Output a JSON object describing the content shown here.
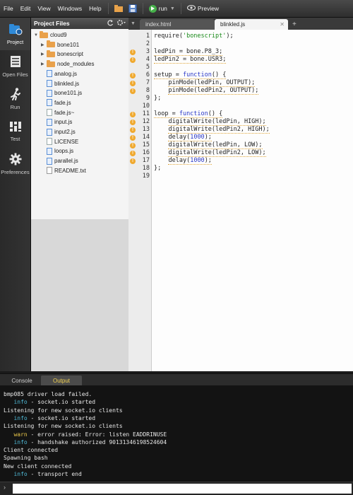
{
  "menubar": {
    "items": [
      "File",
      "Edit",
      "View",
      "Windows",
      "Help"
    ],
    "run_label": "run",
    "preview_label": "Preview"
  },
  "leftbar": {
    "items": [
      {
        "label": "Project",
        "icon": "project-icon",
        "active": true
      },
      {
        "label": "Open Files",
        "icon": "open-files-icon",
        "active": false
      },
      {
        "label": "Run",
        "icon": "run-icon",
        "active": false
      },
      {
        "label": "Test",
        "icon": "test-icon",
        "active": false
      },
      {
        "label": "Preferences",
        "icon": "preferences-icon",
        "active": false
      }
    ]
  },
  "tree": {
    "title": "Project Files",
    "items": [
      {
        "name": "cloud9",
        "type": "folder",
        "expanded": true,
        "depth": 0
      },
      {
        "name": "bone101",
        "type": "folder",
        "expanded": false,
        "depth": 1
      },
      {
        "name": "bonescript",
        "type": "folder",
        "expanded": false,
        "depth": 1
      },
      {
        "name": "node_modules",
        "type": "folder",
        "expanded": false,
        "depth": 1
      },
      {
        "name": "analog.js",
        "type": "js",
        "depth": 1
      },
      {
        "name": "blinkled.js",
        "type": "js",
        "depth": 1
      },
      {
        "name": "bone101.js",
        "type": "js",
        "depth": 1
      },
      {
        "name": "fade.js",
        "type": "js",
        "depth": 1
      },
      {
        "name": "fade.js~",
        "type": "file",
        "depth": 1
      },
      {
        "name": "input.js",
        "type": "js",
        "depth": 1
      },
      {
        "name": "input2.js",
        "type": "js",
        "depth": 1
      },
      {
        "name": "LICENSE",
        "type": "file",
        "depth": 1
      },
      {
        "name": "loops.js",
        "type": "js",
        "depth": 1
      },
      {
        "name": "parallel.js",
        "type": "js",
        "depth": 1
      },
      {
        "name": "README.txt",
        "type": "txt",
        "depth": 1
      }
    ]
  },
  "tabs": [
    {
      "label": "index.html",
      "active": false
    },
    {
      "label": "blinkled.js",
      "active": true
    }
  ],
  "editor": {
    "lines": [
      {
        "n": "1",
        "text": "require('bonescript');",
        "warn": false
      },
      {
        "n": "2",
        "text": "",
        "warn": false
      },
      {
        "n": "3",
        "text": "ledPin = bone.P8_3;",
        "warn": true
      },
      {
        "n": "4",
        "text": "ledPin2 = bone.USR3;",
        "warn": true
      },
      {
        "n": "5",
        "text": "",
        "warn": false
      },
      {
        "n": "6",
        "text": "setup = function() {",
        "warn": true
      },
      {
        "n": "7",
        "text": "    pinMode(ledPin, OUTPUT);",
        "warn": true
      },
      {
        "n": "8",
        "text": "    pinMode(ledPin2, OUTPUT);",
        "warn": true
      },
      {
        "n": "9",
        "text": "};",
        "warn": false
      },
      {
        "n": "10",
        "text": "",
        "warn": false
      },
      {
        "n": "11",
        "text": "loop = function() {",
        "warn": true
      },
      {
        "n": "12",
        "text": "    digitalWrite(ledPin, HIGH);",
        "warn": true
      },
      {
        "n": "13",
        "text": "    digitalWrite(ledPin2, HIGH);",
        "warn": true
      },
      {
        "n": "14",
        "text": "    delay(1000);",
        "warn": true
      },
      {
        "n": "15",
        "text": "    digitalWrite(ledPin, LOW);",
        "warn": true
      },
      {
        "n": "16",
        "text": "    digitalWrite(ledPin2, LOW);",
        "warn": true
      },
      {
        "n": "17",
        "text": "    delay(1000);",
        "warn": true
      },
      {
        "n": "18",
        "text": "};",
        "warn": false
      },
      {
        "n": "19",
        "text": "",
        "warn": false
      }
    ]
  },
  "console": {
    "tabs": [
      {
        "label": "Console",
        "active": false
      },
      {
        "label": "Output",
        "active": true
      }
    ],
    "lines": [
      {
        "level": "",
        "text": "bmp085 driver load failed."
      },
      {
        "level": "info",
        "text": " - socket.io started"
      },
      {
        "level": "",
        "text": "Listening for new socket.io clients"
      },
      {
        "level": "info",
        "text": " - socket.io started"
      },
      {
        "level": "",
        "text": "Listening for new socket.io clients"
      },
      {
        "level": "warn",
        "text": " - error raised: Error: listen EADDRINUSE"
      },
      {
        "level": "info",
        "text": " - handshake authorized 90131346198524604"
      },
      {
        "level": "",
        "text": "Client connected"
      },
      {
        "level": "",
        "text": "Spawning bash"
      },
      {
        "level": "",
        "text": "New client connected"
      },
      {
        "level": "info",
        "text": " - transport end"
      }
    ],
    "prompt_value": ""
  },
  "colors": {
    "accent": "#46b04a",
    "warning": "#f0a92e",
    "info": "#4fb9d6"
  }
}
